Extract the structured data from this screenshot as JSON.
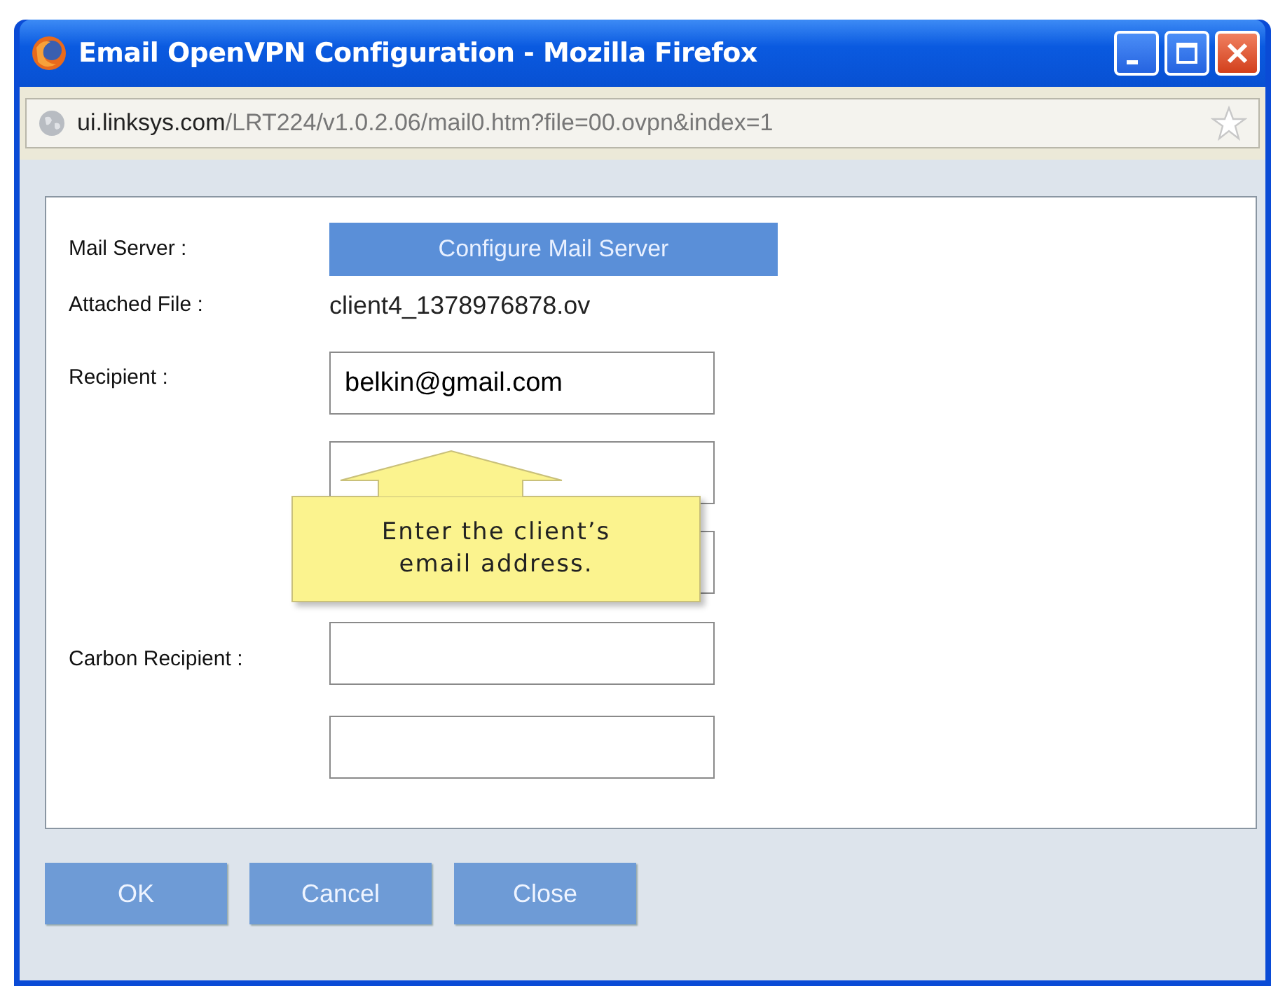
{
  "window": {
    "title": "Email OpenVPN Configuration - Mozilla Firefox"
  },
  "address_bar": {
    "host": "ui.linksys.com",
    "path": "/LRT224/v1.0.2.06/mail0.htm?file=00.ovpn&index=1"
  },
  "form": {
    "mail_server": {
      "label": "Mail Server :",
      "button": "Configure Mail Server"
    },
    "attached_file": {
      "label": "Attached File :",
      "value": "client4_1378976878.ov"
    },
    "recipient": {
      "label": "Recipient :",
      "fields": [
        {
          "kind": "text",
          "value": "belkin@gmail.com"
        },
        {
          "kind": "text"
        },
        {
          "kind": "text"
        }
      ]
    },
    "carbon_recipient": {
      "label": "Carbon Recipient :",
      "fields": [
        {
          "kind": "text"
        },
        {
          "kind": "text"
        }
      ]
    }
  },
  "callout": {
    "text": "Enter the client’s email address."
  },
  "buttons": [
    "OK",
    "Cancel",
    "Close"
  ]
}
